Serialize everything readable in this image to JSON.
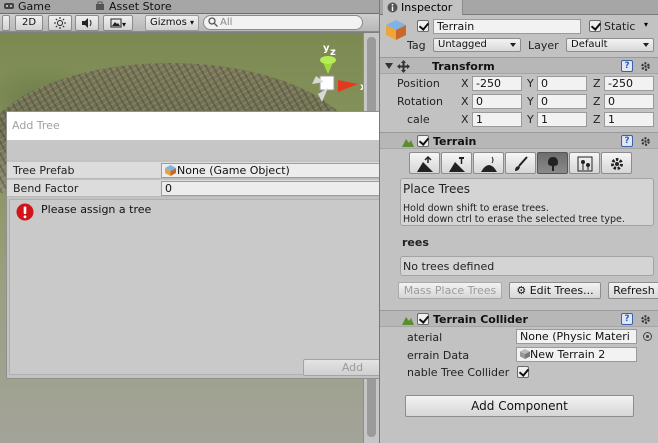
{
  "scene": {
    "tabs": [
      {
        "label": "Game",
        "icon": "game-icon"
      },
      {
        "label": "Asset Store",
        "icon": "asset-store-icon"
      }
    ],
    "toolbar": {
      "mode_2d": "2D",
      "gizmos_label": "Gizmos",
      "search_placeholder": "All"
    },
    "gizmo": {
      "y_label": "y",
      "z_label": "z",
      "x_label": "x"
    }
  },
  "dialog": {
    "title": "Add Tree",
    "fields": [
      {
        "label": "Tree Prefab",
        "value": "None (Game Object)"
      },
      {
        "label": "Bend Factor",
        "value": "0"
      }
    ],
    "error_message": "Please assign a tree",
    "add_button": "Add"
  },
  "inspector": {
    "tab_label": "Inspector",
    "object_name": "Terrain",
    "static_label": "Static",
    "tag_label": "Tag",
    "tag_value": "Untagged",
    "layer_label": "Layer",
    "layer_value": "Default",
    "transform": {
      "title": "Transform",
      "rows": [
        {
          "label": "Position",
          "x": "-250",
          "y": "0",
          "z": "-250"
        },
        {
          "label": "Rotation",
          "x": "0",
          "y": "0",
          "z": "0"
        },
        {
          "label": "cale",
          "x": "1",
          "y": "1",
          "z": "1"
        }
      ],
      "axis_x": "X",
      "axis_y": "Y",
      "axis_z": "Z"
    },
    "terrain": {
      "title": "Terrain",
      "mode_title": "Place Trees",
      "hint_1": "Hold down shift to erase trees.",
      "hint_2": "Hold down ctrl to erase the selected tree type.",
      "trees_heading": "rees",
      "no_trees": "No trees defined",
      "mass_place": "Mass Place Trees",
      "edit_trees": "Edit Trees...",
      "refresh": "Refresh"
    },
    "collider": {
      "title": "Terrain Collider",
      "material_label": "aterial",
      "material_value": "None (Physic Materi",
      "data_label": "errain Data",
      "data_value": "New Terrain 2",
      "tree_collider_label": "nable Tree Collider"
    },
    "add_component": "Add Component",
    "help_glyph": "?"
  }
}
